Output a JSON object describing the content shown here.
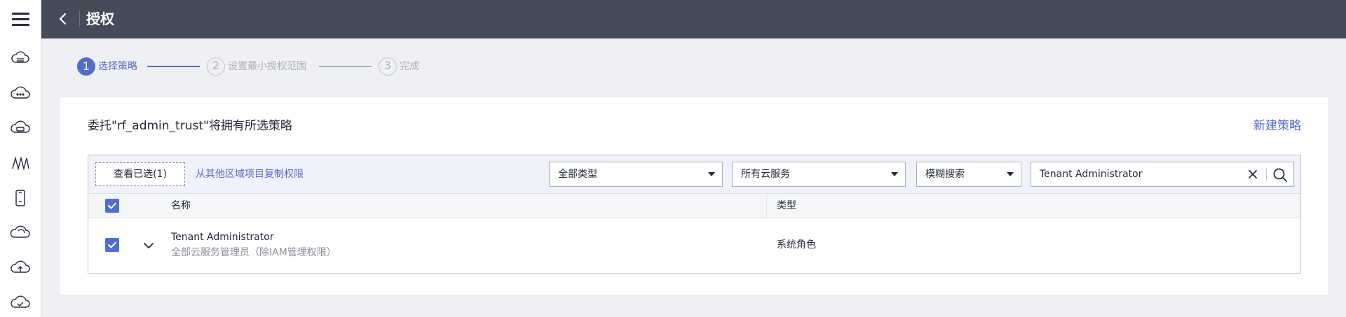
{
  "header": {
    "title": "授权"
  },
  "rail": {
    "icons": [
      "menu-icon",
      "cloud-server-icon",
      "cloud-dots-icon",
      "cloud-storage-icon",
      "wave-icon",
      "phone-icon",
      "cloud-shape-icon",
      "cloud-upload-icon",
      "cloud-check-icon"
    ]
  },
  "steps": [
    {
      "num": "1",
      "label": "选择策略",
      "state": "active"
    },
    {
      "num": "2",
      "label": "设置最小授权范围",
      "state": "todo"
    },
    {
      "num": "3",
      "label": "完成",
      "state": "todo"
    }
  ],
  "card": {
    "heading": "委托\"rf_admin_trust\"将拥有所选策略",
    "new_policy": "新建策略"
  },
  "toolbar": {
    "view_selected": "查看已选(1)",
    "copy_link": "从其他区域项目复制权限",
    "filter_type": "全部类型",
    "filter_service": "所有云服务",
    "search_mode": "模糊搜索",
    "search_value": "Tenant Administrator"
  },
  "table": {
    "columns": [
      "名称",
      "类型"
    ],
    "rows": [
      {
        "name": "Tenant Administrator",
        "desc": "全部云服务管理员（除IAM管理权限）",
        "type": "系统角色",
        "checked": true
      }
    ]
  },
  "colors": {
    "accent": "#526ecc",
    "header_bg": "#454b58",
    "page_bg": "#eff0f3"
  }
}
